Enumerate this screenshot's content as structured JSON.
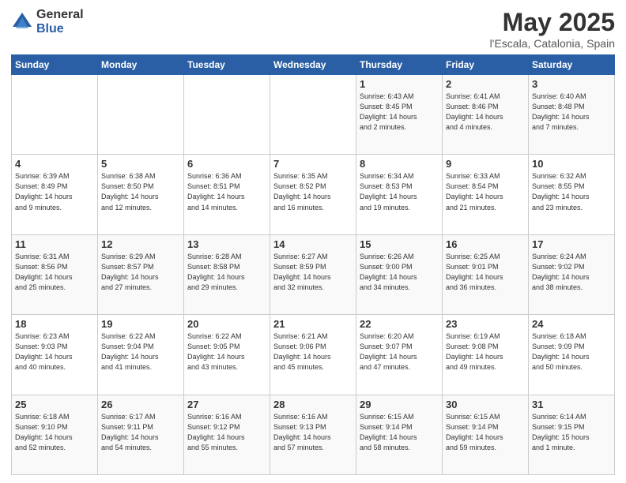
{
  "logo": {
    "general": "General",
    "blue": "Blue"
  },
  "header": {
    "title": "May 2025",
    "subtitle": "l'Escala, Catalonia, Spain"
  },
  "weekdays": [
    "Sunday",
    "Monday",
    "Tuesday",
    "Wednesday",
    "Thursday",
    "Friday",
    "Saturday"
  ],
  "weeks": [
    [
      {
        "day": "",
        "info": ""
      },
      {
        "day": "",
        "info": ""
      },
      {
        "day": "",
        "info": ""
      },
      {
        "day": "",
        "info": ""
      },
      {
        "day": "1",
        "info": "Sunrise: 6:43 AM\nSunset: 8:45 PM\nDaylight: 14 hours\nand 2 minutes."
      },
      {
        "day": "2",
        "info": "Sunrise: 6:41 AM\nSunset: 8:46 PM\nDaylight: 14 hours\nand 4 minutes."
      },
      {
        "day": "3",
        "info": "Sunrise: 6:40 AM\nSunset: 8:48 PM\nDaylight: 14 hours\nand 7 minutes."
      }
    ],
    [
      {
        "day": "4",
        "info": "Sunrise: 6:39 AM\nSunset: 8:49 PM\nDaylight: 14 hours\nand 9 minutes."
      },
      {
        "day": "5",
        "info": "Sunrise: 6:38 AM\nSunset: 8:50 PM\nDaylight: 14 hours\nand 12 minutes."
      },
      {
        "day": "6",
        "info": "Sunrise: 6:36 AM\nSunset: 8:51 PM\nDaylight: 14 hours\nand 14 minutes."
      },
      {
        "day": "7",
        "info": "Sunrise: 6:35 AM\nSunset: 8:52 PM\nDaylight: 14 hours\nand 16 minutes."
      },
      {
        "day": "8",
        "info": "Sunrise: 6:34 AM\nSunset: 8:53 PM\nDaylight: 14 hours\nand 19 minutes."
      },
      {
        "day": "9",
        "info": "Sunrise: 6:33 AM\nSunset: 8:54 PM\nDaylight: 14 hours\nand 21 minutes."
      },
      {
        "day": "10",
        "info": "Sunrise: 6:32 AM\nSunset: 8:55 PM\nDaylight: 14 hours\nand 23 minutes."
      }
    ],
    [
      {
        "day": "11",
        "info": "Sunrise: 6:31 AM\nSunset: 8:56 PM\nDaylight: 14 hours\nand 25 minutes."
      },
      {
        "day": "12",
        "info": "Sunrise: 6:29 AM\nSunset: 8:57 PM\nDaylight: 14 hours\nand 27 minutes."
      },
      {
        "day": "13",
        "info": "Sunrise: 6:28 AM\nSunset: 8:58 PM\nDaylight: 14 hours\nand 29 minutes."
      },
      {
        "day": "14",
        "info": "Sunrise: 6:27 AM\nSunset: 8:59 PM\nDaylight: 14 hours\nand 32 minutes."
      },
      {
        "day": "15",
        "info": "Sunrise: 6:26 AM\nSunset: 9:00 PM\nDaylight: 14 hours\nand 34 minutes."
      },
      {
        "day": "16",
        "info": "Sunrise: 6:25 AM\nSunset: 9:01 PM\nDaylight: 14 hours\nand 36 minutes."
      },
      {
        "day": "17",
        "info": "Sunrise: 6:24 AM\nSunset: 9:02 PM\nDaylight: 14 hours\nand 38 minutes."
      }
    ],
    [
      {
        "day": "18",
        "info": "Sunrise: 6:23 AM\nSunset: 9:03 PM\nDaylight: 14 hours\nand 40 minutes."
      },
      {
        "day": "19",
        "info": "Sunrise: 6:22 AM\nSunset: 9:04 PM\nDaylight: 14 hours\nand 41 minutes."
      },
      {
        "day": "20",
        "info": "Sunrise: 6:22 AM\nSunset: 9:05 PM\nDaylight: 14 hours\nand 43 minutes."
      },
      {
        "day": "21",
        "info": "Sunrise: 6:21 AM\nSunset: 9:06 PM\nDaylight: 14 hours\nand 45 minutes."
      },
      {
        "day": "22",
        "info": "Sunrise: 6:20 AM\nSunset: 9:07 PM\nDaylight: 14 hours\nand 47 minutes."
      },
      {
        "day": "23",
        "info": "Sunrise: 6:19 AM\nSunset: 9:08 PM\nDaylight: 14 hours\nand 49 minutes."
      },
      {
        "day": "24",
        "info": "Sunrise: 6:18 AM\nSunset: 9:09 PM\nDaylight: 14 hours\nand 50 minutes."
      }
    ],
    [
      {
        "day": "25",
        "info": "Sunrise: 6:18 AM\nSunset: 9:10 PM\nDaylight: 14 hours\nand 52 minutes."
      },
      {
        "day": "26",
        "info": "Sunrise: 6:17 AM\nSunset: 9:11 PM\nDaylight: 14 hours\nand 54 minutes."
      },
      {
        "day": "27",
        "info": "Sunrise: 6:16 AM\nSunset: 9:12 PM\nDaylight: 14 hours\nand 55 minutes."
      },
      {
        "day": "28",
        "info": "Sunrise: 6:16 AM\nSunset: 9:13 PM\nDaylight: 14 hours\nand 57 minutes."
      },
      {
        "day": "29",
        "info": "Sunrise: 6:15 AM\nSunset: 9:14 PM\nDaylight: 14 hours\nand 58 minutes."
      },
      {
        "day": "30",
        "info": "Sunrise: 6:15 AM\nSunset: 9:14 PM\nDaylight: 14 hours\nand 59 minutes."
      },
      {
        "day": "31",
        "info": "Sunrise: 6:14 AM\nSunset: 9:15 PM\nDaylight: 15 hours\nand 1 minute."
      }
    ]
  ]
}
